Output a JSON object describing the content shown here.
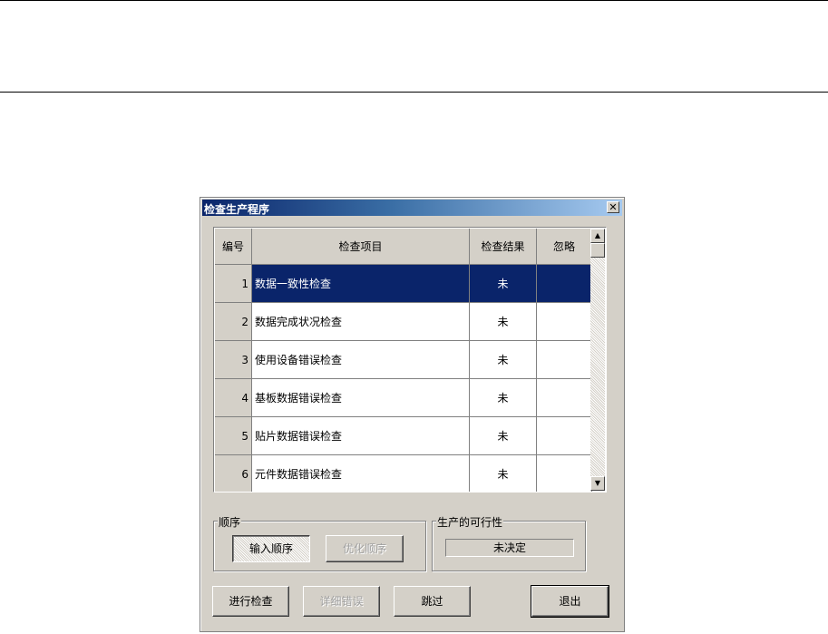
{
  "dialog": {
    "title": "检查生产程序",
    "close_glyph": "✕"
  },
  "grid": {
    "headers": {
      "num": "编号",
      "item": "检查项目",
      "result": "检查结果",
      "ignore": "忽略"
    },
    "rows": [
      {
        "num": "1",
        "item": "数据一致性检查",
        "result": "未",
        "ignore": "",
        "selected": true
      },
      {
        "num": "2",
        "item": "数据完成状况检查",
        "result": "未",
        "ignore": ""
      },
      {
        "num": "3",
        "item": "使用设备错误检查",
        "result": "未",
        "ignore": ""
      },
      {
        "num": "4",
        "item": "基板数据错误检查",
        "result": "未",
        "ignore": ""
      },
      {
        "num": "5",
        "item": "贴片数据错误检查",
        "result": "未",
        "ignore": ""
      },
      {
        "num": "6",
        "item": "元件数据错误检查",
        "result": "未",
        "ignore": ""
      }
    ],
    "scroll_up_glyph": "▲",
    "scroll_down_glyph": "▼",
    "selection_color": "#0a246a"
  },
  "order_group": {
    "label": "顺序",
    "input_order_label": "输入顺序",
    "optimize_order_label": "优化顺序"
  },
  "feasibility_group": {
    "label": "生产的可行性",
    "status": "未决定"
  },
  "buttons": {
    "run_check": "进行检查",
    "error_detail": "详细错误",
    "skip": "跳过",
    "exit": "退出"
  }
}
